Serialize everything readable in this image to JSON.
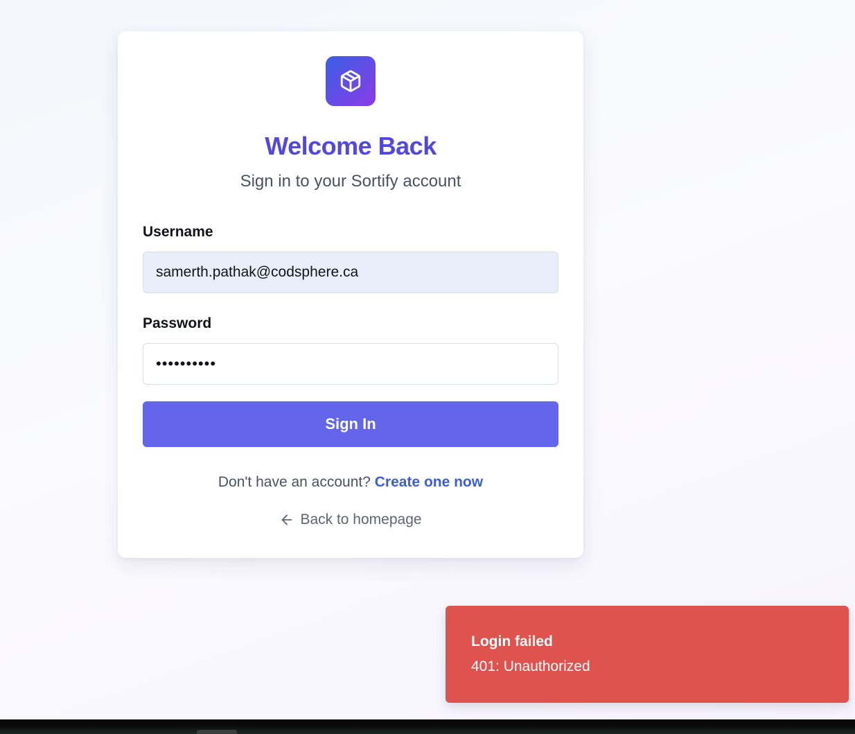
{
  "colors": {
    "accent": "#6366ea",
    "title": "#5048e0",
    "link": "#3a5fdc",
    "toast_error": "#df534f",
    "username_field_bg": "#e8effb"
  },
  "login": {
    "logo_icon": "package-cube-icon",
    "title": "Welcome Back",
    "subtitle": "Sign in to your Sortify account",
    "username_label": "Username",
    "username_value": "samerth.pathak@codsphere.ca",
    "password_label": "Password",
    "password_value": "••••••••••",
    "signin_label": "Sign In",
    "signup_prompt": "Don't have an account?",
    "signup_link": "Create one now",
    "back_icon": "arrow-left-icon",
    "back_label": "Back to homepage"
  },
  "toast": {
    "title": "Login failed",
    "message": "401: Unauthorized"
  }
}
